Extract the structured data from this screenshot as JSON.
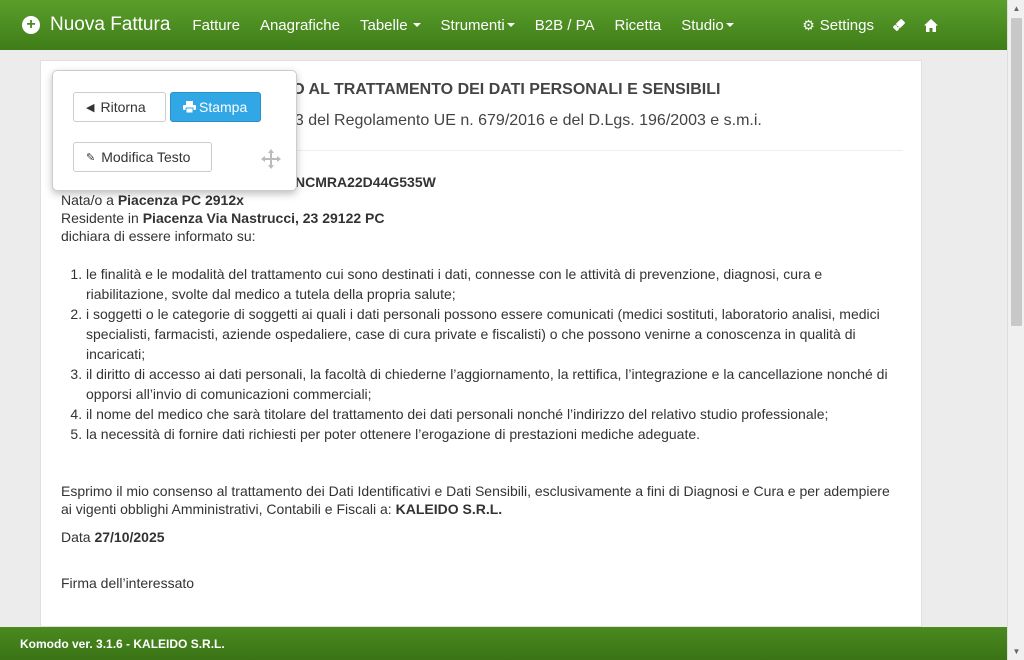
{
  "app": {
    "brand": "Nuova Fattura"
  },
  "nav": {
    "items": [
      {
        "label": "Fatture",
        "dropdown": false
      },
      {
        "label": "Anagrafiche",
        "dropdown": false
      },
      {
        "label": "Tabelle",
        "dropdown": true
      },
      {
        "label": "Strumenti",
        "dropdown": true
      },
      {
        "label": "B2B / PA",
        "dropdown": false
      },
      {
        "label": "Ricetta",
        "dropdown": false
      },
      {
        "label": "Studio",
        "dropdown": true
      }
    ],
    "settings_label": "Settings",
    "right_icons": [
      "ticket-icon",
      "home-icon"
    ]
  },
  "toolbar": {
    "back_label": "Ritorna",
    "print_label": "Stampa",
    "edit_label": "Modifica Testo"
  },
  "document": {
    "title_visible": "SO AL TRATTAMENTO DEI DATI PERSONALI E SENSIBILI",
    "subtitle_visible": "13 del Regolamento UE n. 679/2016 e del D.Lgs. 196/2003 e s.m.i.",
    "cf_visible": "NCMRA22D44G535W",
    "born_prefix": "Nata/o a ",
    "born_value": "Piacenza PC 2912x",
    "resident_prefix": "Residente in ",
    "resident_value": "Piacenza Via Nastrucci, 23 29122 PC",
    "declaration": "dichiara di essere informato su:",
    "list": [
      "le finalità e le modalità del trattamento cui sono destinati i dati, connesse con le attività di prevenzione, diagnosi, cura e riabilitazione, svolte dal medico a tutela della propria salute;",
      "i soggetti o le categorie di soggetti ai quali i dati personali possono essere comunicati (medici sostituti, laboratorio analisi, medici specialisti, farmacisti, aziende ospedaliere, case di cura private e fiscalisti) o che possono venirne a conoscenza in qualità di incaricati;",
      "il diritto di accesso ai dati personali, la facoltà di chiederne l’aggiornamento, la rettifica, l’integrazione e la cancellazione nonché di opporsi all’invio di comunicazioni commerciali;",
      "il nome del medico che sarà titolare del trattamento dei dati personali nonché l’indirizzo del relativo studio professionale;",
      "la necessità di fornire dati richiesti per poter ottenere l’erogazione di prestazioni mediche adeguate."
    ],
    "consent_text": "Esprimo il mio consenso al trattamento dei Dati Identificativi e Dati Sensibili, esclusivamente a fini di Diagnosi e Cura e per adempiere ai vigenti obblighi Amministrativi, Contabili e Fiscali a: ",
    "consent_company": "KALEIDO S.R.L.",
    "date_prefix": "Data ",
    "date_value": "27/10/2025",
    "signature_label": "Firma dell’interessato"
  },
  "footer": {
    "text": "Komodo ver. 3.1.6 - KALEIDO S.R.L."
  },
  "colors": {
    "navbar": "#4a8c1f",
    "primary_button": "#32a7e6"
  }
}
